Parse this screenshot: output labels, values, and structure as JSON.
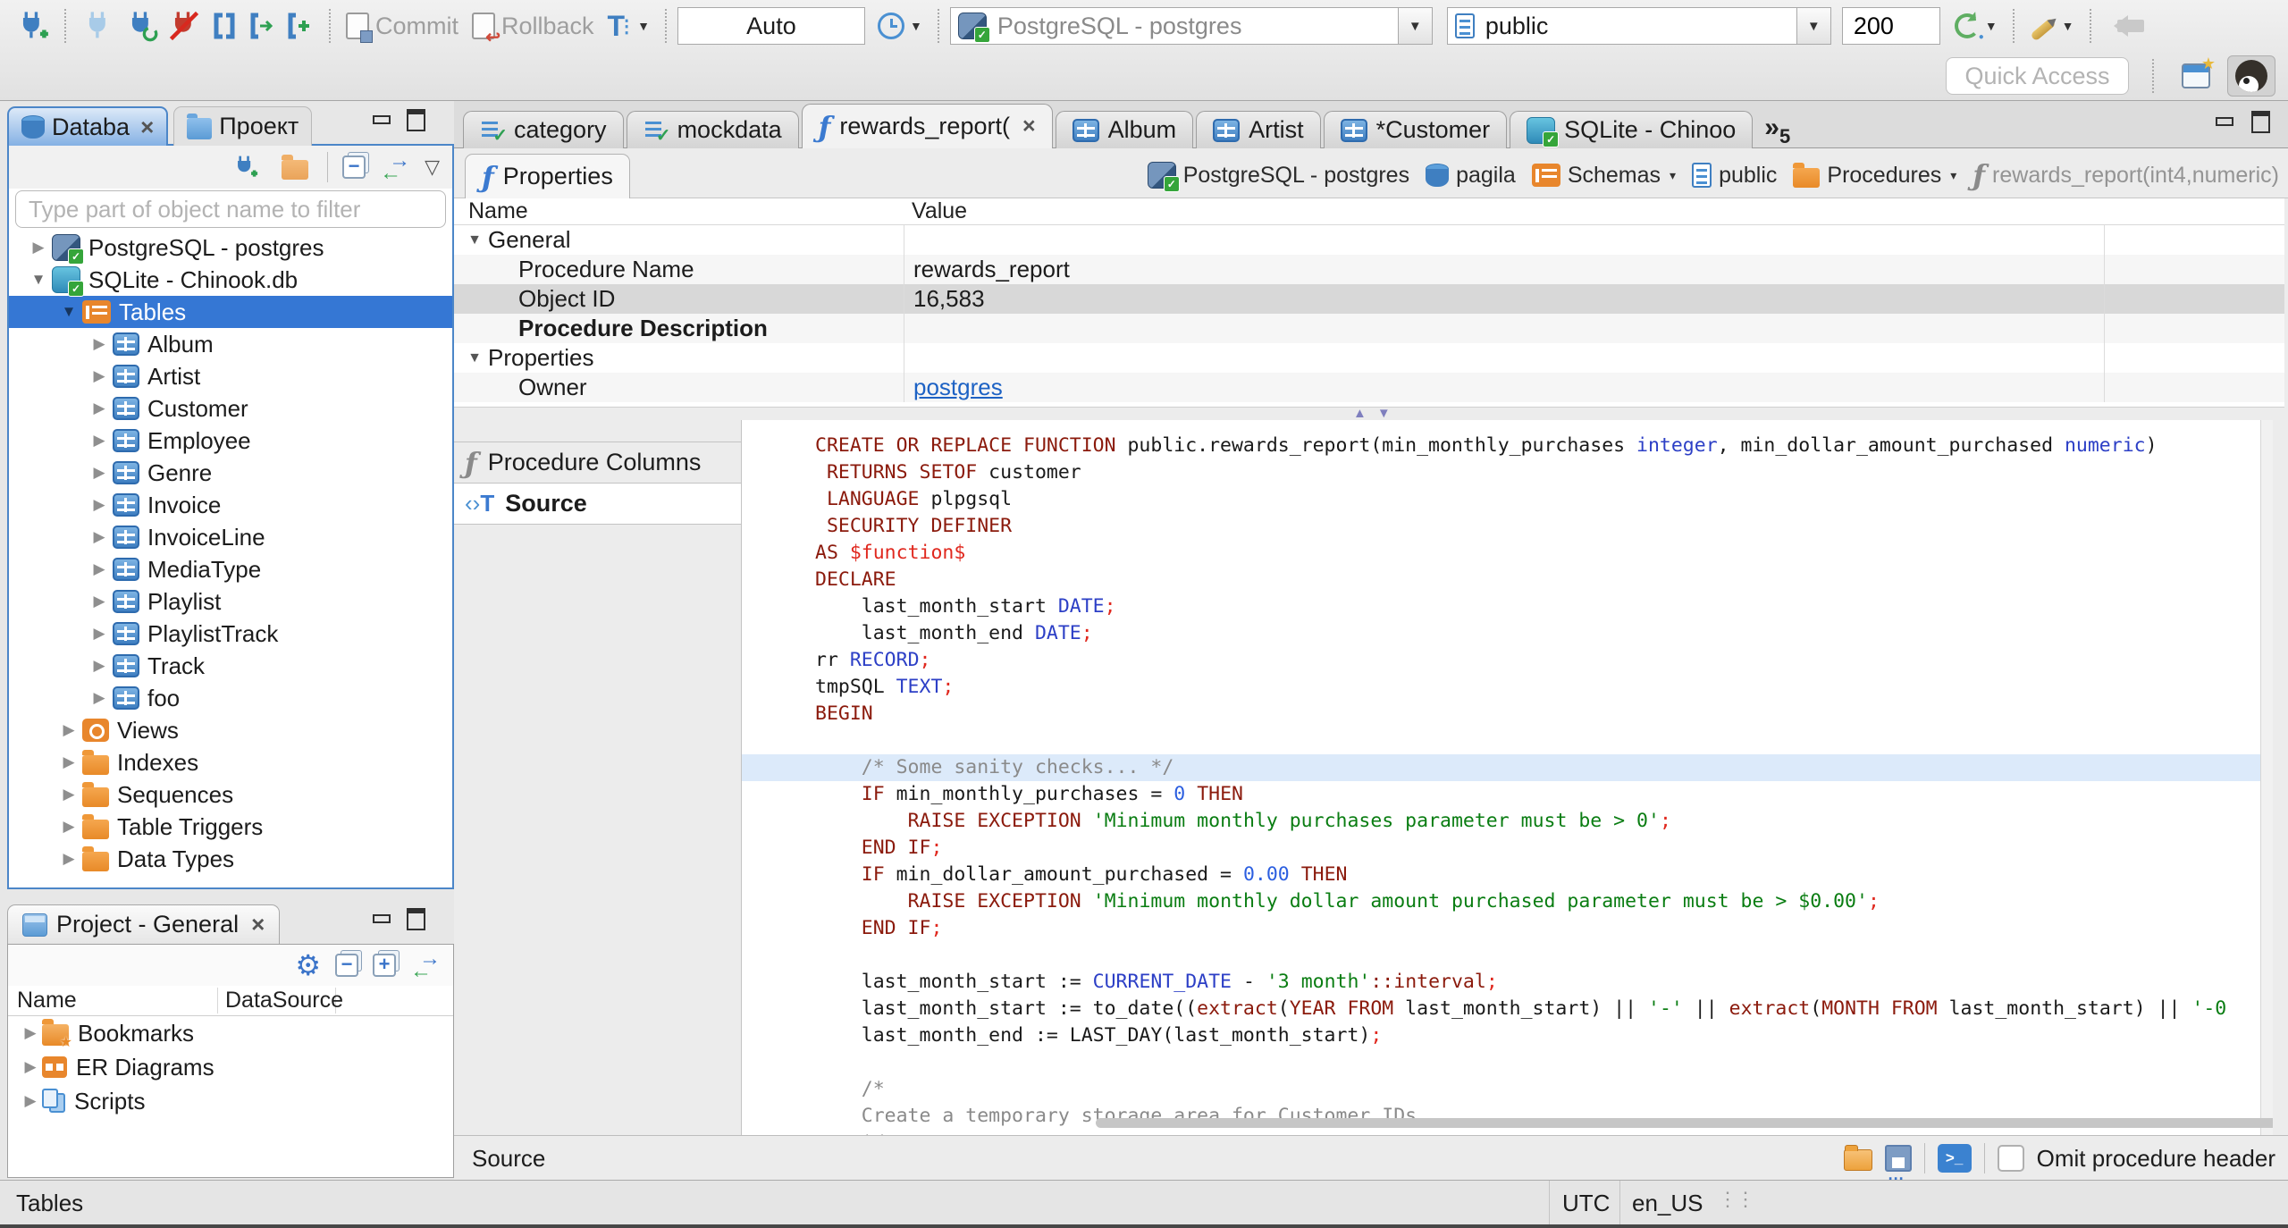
{
  "toolbar": {
    "commit_label": "Commit",
    "rollback_label": "Rollback",
    "auto_label": "Auto",
    "connection_value": "PostgreSQL - postgres",
    "schema_value": "public",
    "fetch_size": "200",
    "quick_access_placeholder": "Quick Access"
  },
  "nav_panel": {
    "tab_database": "Databa",
    "tab_projects": "Проект",
    "filter_placeholder": "Type part of object name to filter",
    "tree": [
      {
        "label": "PostgreSQL - postgres",
        "icon": "pgdb",
        "level": 0,
        "arrow": "right"
      },
      {
        "label": "SQLite - Chinook.db",
        "icon": "sqlitedb",
        "level": 0,
        "arrow": "down"
      },
      {
        "label": "Tables",
        "icon": "tablesfolder",
        "level": 1,
        "arrow": "down",
        "selected": true
      },
      {
        "label": "Album",
        "icon": "table",
        "level": 2,
        "arrow": "right"
      },
      {
        "label": "Artist",
        "icon": "table",
        "level": 2,
        "arrow": "right"
      },
      {
        "label": "Customer",
        "icon": "table",
        "level": 2,
        "arrow": "right"
      },
      {
        "label": "Employee",
        "icon": "table",
        "level": 2,
        "arrow": "right"
      },
      {
        "label": "Genre",
        "icon": "table",
        "level": 2,
        "arrow": "right"
      },
      {
        "label": "Invoice",
        "icon": "table",
        "level": 2,
        "arrow": "right"
      },
      {
        "label": "InvoiceLine",
        "icon": "table",
        "level": 2,
        "arrow": "right"
      },
      {
        "label": "MediaType",
        "icon": "table",
        "level": 2,
        "arrow": "right"
      },
      {
        "label": "Playlist",
        "icon": "table",
        "level": 2,
        "arrow": "right"
      },
      {
        "label": "PlaylistTrack",
        "icon": "table",
        "level": 2,
        "arrow": "right"
      },
      {
        "label": "Track",
        "icon": "table",
        "level": 2,
        "arrow": "right"
      },
      {
        "label": "foo",
        "icon": "table",
        "level": 2,
        "arrow": "right"
      },
      {
        "label": "Views",
        "icon": "views",
        "level": 1,
        "arrow": "right"
      },
      {
        "label": "Indexes",
        "icon": "folder",
        "level": 1,
        "arrow": "right"
      },
      {
        "label": "Sequences",
        "icon": "folder",
        "level": 1,
        "arrow": "right"
      },
      {
        "label": "Table Triggers",
        "icon": "folder",
        "level": 1,
        "arrow": "right"
      },
      {
        "label": "Data Types",
        "icon": "folder",
        "level": 1,
        "arrow": "right"
      }
    ]
  },
  "project_panel": {
    "title": "Project - General",
    "columns": [
      "Name",
      "DataSource"
    ],
    "rows": [
      {
        "label": "Bookmarks",
        "icon": "bookmarks"
      },
      {
        "label": "ER Diagrams",
        "icon": "erd"
      },
      {
        "label": "Scripts",
        "icon": "scripts"
      }
    ]
  },
  "editor": {
    "tabs": [
      {
        "label": "category",
        "icon": "sqlscript"
      },
      {
        "label": "mockdata",
        "icon": "sqlscript"
      },
      {
        "label": "rewards_report(",
        "icon": "func",
        "active": true,
        "close": true
      },
      {
        "label": "Album",
        "icon": "table"
      },
      {
        "label": "Artist",
        "icon": "table"
      },
      {
        "label": "*Customer",
        "icon": "table"
      },
      {
        "label": "SQLite - Chinoo",
        "icon": "sqlitedb"
      }
    ],
    "overflow_count": "5",
    "properties_tab": "Properties",
    "breadcrumb": [
      {
        "label": "PostgreSQL - postgres",
        "icon": "pgdb"
      },
      {
        "label": "pagila",
        "icon": "dbstack"
      },
      {
        "label": "Schemas",
        "icon": "tablesfolder",
        "dropdown": true
      },
      {
        "label": "public",
        "icon": "page"
      },
      {
        "label": "Procedures",
        "icon": "folder",
        "dropdown": true
      },
      {
        "label": "rewards_report(int4,numeric)",
        "icon": "func",
        "muted": true
      }
    ],
    "grid": {
      "name_col": "Name",
      "value_col": "Value",
      "rows": [
        {
          "name": "General",
          "type": "group"
        },
        {
          "name": "Procedure Name",
          "value": "rewards_report",
          "stripe": true
        },
        {
          "name": "Object ID",
          "value": "16,583",
          "selected": true
        },
        {
          "name": "Procedure Description",
          "bold": true,
          "stripe": true
        },
        {
          "name": "Properties",
          "type": "group"
        },
        {
          "name": "Owner",
          "value": "postgres",
          "link": true,
          "stripe": true
        }
      ]
    },
    "subtabs": {
      "columns": "Procedure Columns",
      "source": "Source"
    },
    "bottom": {
      "label": "Source",
      "omit_label": "Omit procedure header"
    }
  },
  "source": {
    "highlight_line": 12,
    "lines": [
      [
        {
          "c": "k",
          "t": "CREATE OR REPLACE FUNCTION"
        },
        {
          "c": "b",
          "t": " public.rewards_report(min_monthly_purchases "
        },
        {
          "c": "t",
          "t": "integer"
        },
        {
          "c": "b",
          "t": ", min_dollar_amount_purchased "
        },
        {
          "c": "t",
          "t": "numeric"
        },
        {
          "c": "b",
          "t": ")"
        }
      ],
      [
        {
          "c": "b",
          "t": " "
        },
        {
          "c": "k",
          "t": "RETURNS SETOF"
        },
        {
          "c": "b",
          "t": " customer"
        }
      ],
      [
        {
          "c": "b",
          "t": " "
        },
        {
          "c": "k",
          "t": "LANGUAGE"
        },
        {
          "c": "b",
          "t": " plpgsql"
        }
      ],
      [
        {
          "c": "b",
          "t": " "
        },
        {
          "c": "k",
          "t": "SECURITY DEFINER"
        }
      ],
      [
        {
          "c": "k",
          "t": "AS "
        },
        {
          "c": "r",
          "t": "$function$"
        }
      ],
      [
        {
          "c": "k",
          "t": "DECLARE"
        }
      ],
      [
        {
          "c": "b",
          "t": "    last_month_start "
        },
        {
          "c": "t",
          "t": "DATE"
        },
        {
          "c": "r",
          "t": ";"
        }
      ],
      [
        {
          "c": "b",
          "t": "    last_month_end "
        },
        {
          "c": "t",
          "t": "DATE"
        },
        {
          "c": "r",
          "t": ";"
        }
      ],
      [
        {
          "c": "b",
          "t": "rr "
        },
        {
          "c": "t",
          "t": "RECORD"
        },
        {
          "c": "r",
          "t": ";"
        }
      ],
      [
        {
          "c": "b",
          "t": "tmpSQL "
        },
        {
          "c": "t",
          "t": "TEXT"
        },
        {
          "c": "r",
          "t": ";"
        }
      ],
      [
        {
          "c": "k",
          "t": "BEGIN"
        }
      ],
      [],
      [
        {
          "c": "c",
          "t": "    /* Some sanity checks... */"
        }
      ],
      [
        {
          "c": "b",
          "t": "    "
        },
        {
          "c": "k",
          "t": "IF"
        },
        {
          "c": "b",
          "t": " min_monthly_purchases = "
        },
        {
          "c": "n",
          "t": "0"
        },
        {
          "c": "b",
          "t": " "
        },
        {
          "c": "k",
          "t": "THEN"
        }
      ],
      [
        {
          "c": "b",
          "t": "        "
        },
        {
          "c": "k",
          "t": "RAISE EXCEPTION"
        },
        {
          "c": "b",
          "t": " "
        },
        {
          "c": "s",
          "t": "'Minimum monthly purchases parameter must be > 0'"
        },
        {
          "c": "r",
          "t": ";"
        }
      ],
      [
        {
          "c": "b",
          "t": "    "
        },
        {
          "c": "k",
          "t": "END IF"
        },
        {
          "c": "r",
          "t": ";"
        }
      ],
      [
        {
          "c": "b",
          "t": "    "
        },
        {
          "c": "k",
          "t": "IF"
        },
        {
          "c": "b",
          "t": " min_dollar_amount_purchased = "
        },
        {
          "c": "n",
          "t": "0.00"
        },
        {
          "c": "b",
          "t": " "
        },
        {
          "c": "k",
          "t": "THEN"
        }
      ],
      [
        {
          "c": "b",
          "t": "        "
        },
        {
          "c": "k",
          "t": "RAISE EXCEPTION"
        },
        {
          "c": "b",
          "t": " "
        },
        {
          "c": "s",
          "t": "'Minimum monthly dollar amount purchased parameter must be > $0.00'"
        },
        {
          "c": "r",
          "t": ";"
        }
      ],
      [
        {
          "c": "b",
          "t": "    "
        },
        {
          "c": "k",
          "t": "END IF"
        },
        {
          "c": "r",
          "t": ";"
        }
      ],
      [],
      [
        {
          "c": "b",
          "t": "    last_month_start := "
        },
        {
          "c": "t",
          "t": "CURRENT_DATE"
        },
        {
          "c": "b",
          "t": " - "
        },
        {
          "c": "s",
          "t": "'3 month'"
        },
        {
          "c": "k",
          "t": "::interval"
        },
        {
          "c": "r",
          "t": ";"
        }
      ],
      [
        {
          "c": "b",
          "t": "    last_month_start := to_date(("
        },
        {
          "c": "k",
          "t": "extract"
        },
        {
          "c": "b",
          "t": "("
        },
        {
          "c": "k",
          "t": "YEAR FROM"
        },
        {
          "c": "b",
          "t": " last_month_start) || "
        },
        {
          "c": "s",
          "t": "'-'"
        },
        {
          "c": "b",
          "t": " || "
        },
        {
          "c": "k",
          "t": "extract"
        },
        {
          "c": "b",
          "t": "("
        },
        {
          "c": "k",
          "t": "MONTH FROM"
        },
        {
          "c": "b",
          "t": " last_month_start) || "
        },
        {
          "c": "s",
          "t": "'-0"
        }
      ],
      [
        {
          "c": "b",
          "t": "    last_month_end := LAST_DAY(last_month_start)"
        },
        {
          "c": "r",
          "t": ";"
        }
      ],
      [],
      [
        {
          "c": "b",
          "t": "    "
        },
        {
          "c": "c",
          "t": "/*"
        }
      ],
      [
        {
          "c": "c",
          "t": "    Create a temporary storage area for Customer IDs."
        }
      ],
      [
        {
          "c": "c",
          "t": "    */"
        }
      ]
    ]
  },
  "status_bar": {
    "left": "Tables",
    "timezone": "UTC",
    "locale": "en_US"
  }
}
